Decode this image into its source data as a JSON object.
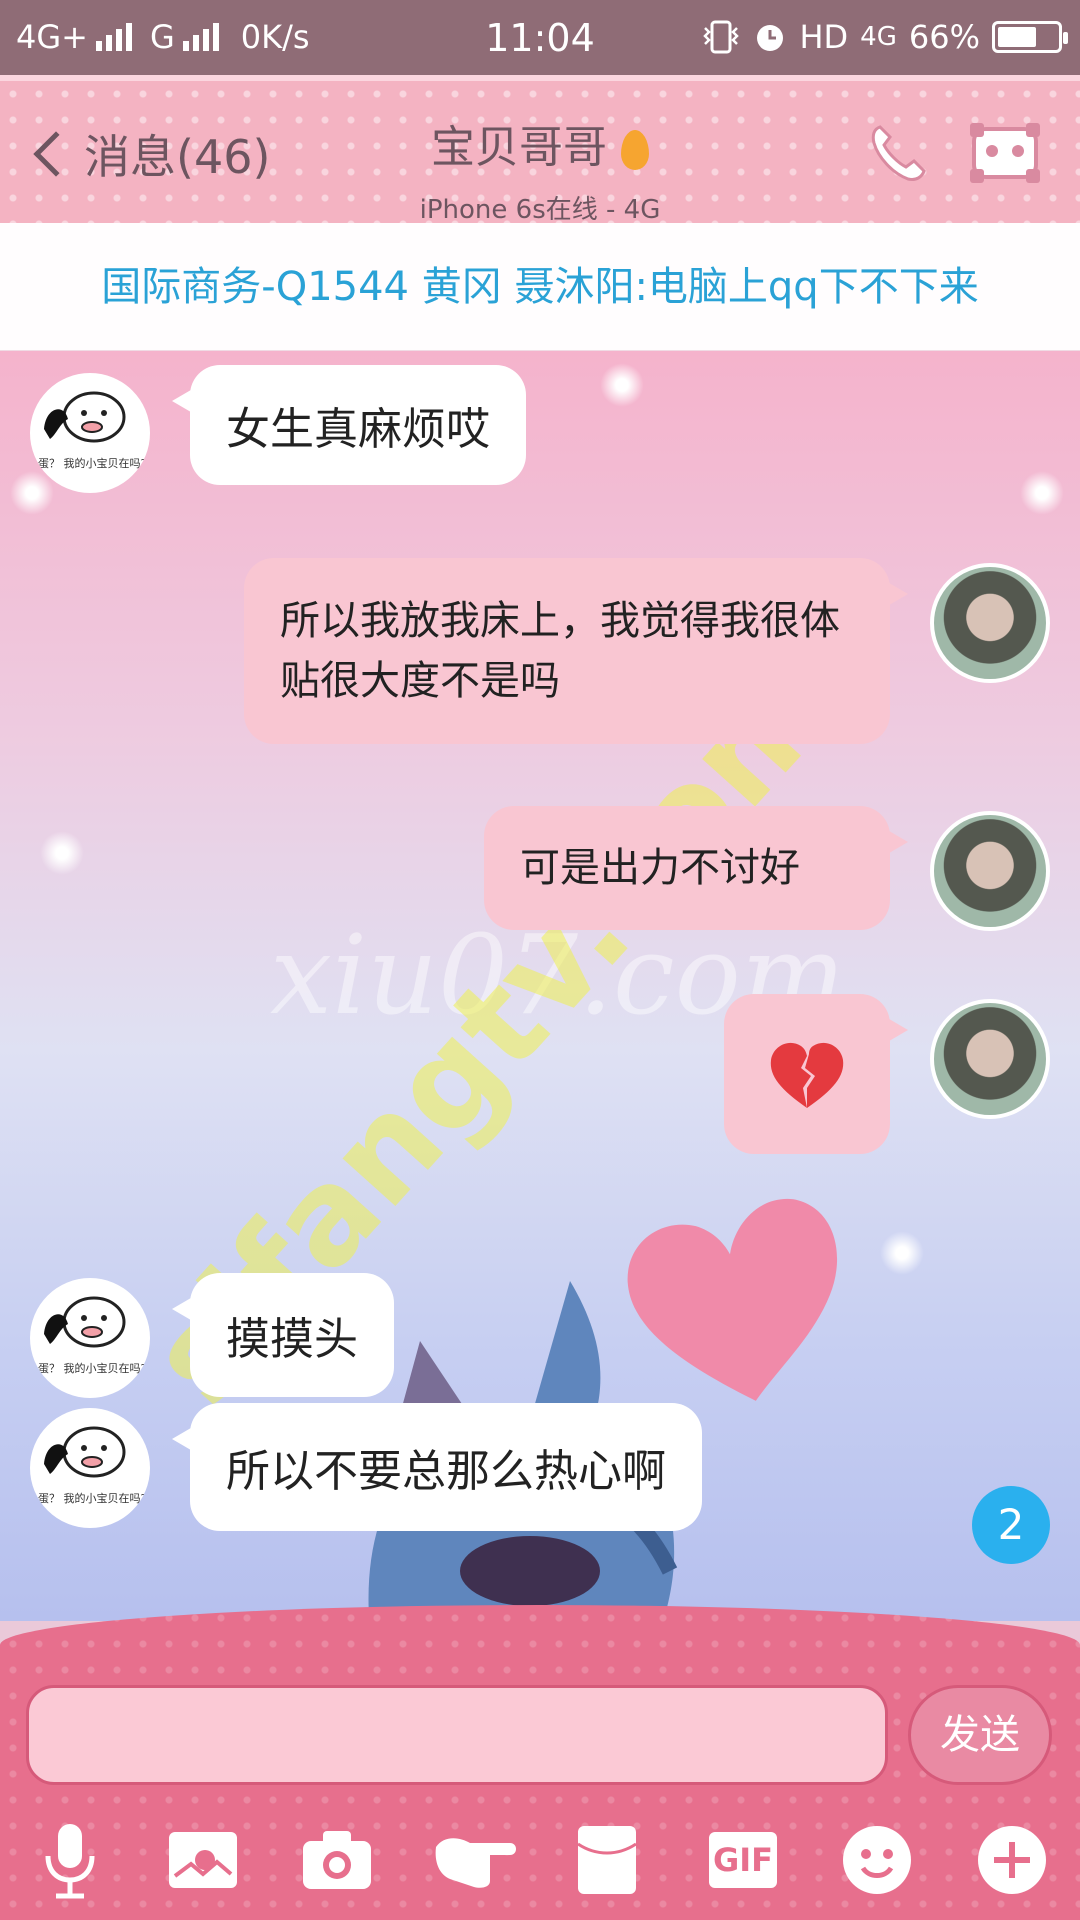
{
  "status_bar": {
    "network1": "4G+",
    "network2": "G",
    "speed": "0K/s",
    "time": "11:04",
    "hd": "HD",
    "network3": "4G",
    "battery_text": "66%",
    "battery_level": 0.66
  },
  "header": {
    "back_label": "消息(46)",
    "contact_name": "宝贝哥哥",
    "online_status": "iPhone 6s在线 - 4G"
  },
  "notice": {
    "text": "国际商务-Q1544 黄冈 聂沐阳:电脑上qq下不下来"
  },
  "messages": [
    {
      "side": "left",
      "text": "女生真麻烦哎"
    },
    {
      "side": "right",
      "text": "所以我放我床上，我觉得我很体贴很大度不是吗"
    },
    {
      "side": "right",
      "text": "可是出力不讨好"
    },
    {
      "side": "right",
      "text": "",
      "emoji": "broken-heart"
    },
    {
      "side": "left",
      "text": "摸摸头"
    },
    {
      "side": "left",
      "text": "所以不要总那么热心啊"
    }
  ],
  "avatar_other_caption": "蛋？ 我的小宝贝在吗?",
  "unread_count": "2",
  "watermarks": [
    "xiu07.com",
    "sifangtv.com"
  ],
  "input": {
    "value": "",
    "send_label": "发送"
  },
  "toolbar": {
    "items": [
      "microphone-icon",
      "image-icon",
      "camera-icon",
      "poke-hand-icon",
      "red-packet-icon",
      "gif-icon",
      "emoji-icon",
      "plus-icon"
    ],
    "gif_label": "GIF"
  },
  "colors": {
    "header_bg": "#f4b3c2",
    "bottom_bg": "#e76f8d",
    "notice_text": "#2aa2d6",
    "my_bubble": "#f9c6d2",
    "badge": "#2ab0ee"
  }
}
